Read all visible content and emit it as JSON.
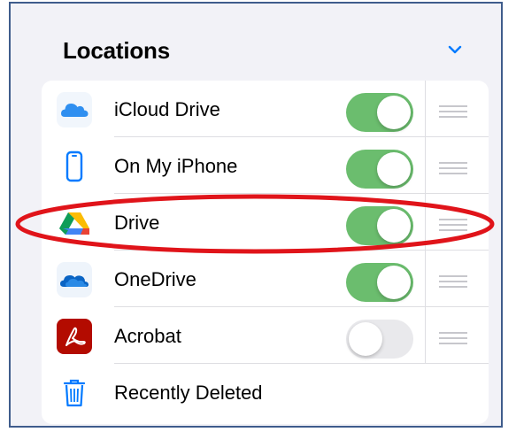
{
  "section": {
    "title": "Locations",
    "chevron_icon": "chevron-down-icon"
  },
  "locations": [
    {
      "label": "iCloud Drive",
      "icon": "icloud-drive-icon",
      "enabled": true
    },
    {
      "label": "On My iPhone",
      "icon": "iphone-icon",
      "enabled": true
    },
    {
      "label": "Drive",
      "icon": "google-drive-icon",
      "enabled": true,
      "highlighted": true
    },
    {
      "label": "OneDrive",
      "icon": "onedrive-icon",
      "enabled": true
    },
    {
      "label": "Acrobat",
      "icon": "acrobat-icon",
      "enabled": false
    }
  ],
  "recently_deleted": {
    "label": "Recently Deleted",
    "icon": "trash-icon"
  },
  "colors": {
    "toggle_on": "#6bbd6e",
    "toggle_off": "#e9e9ec",
    "highlight_oval": "#e0141a",
    "frame_border": "#3f5c8c",
    "accent": "#007aff"
  }
}
